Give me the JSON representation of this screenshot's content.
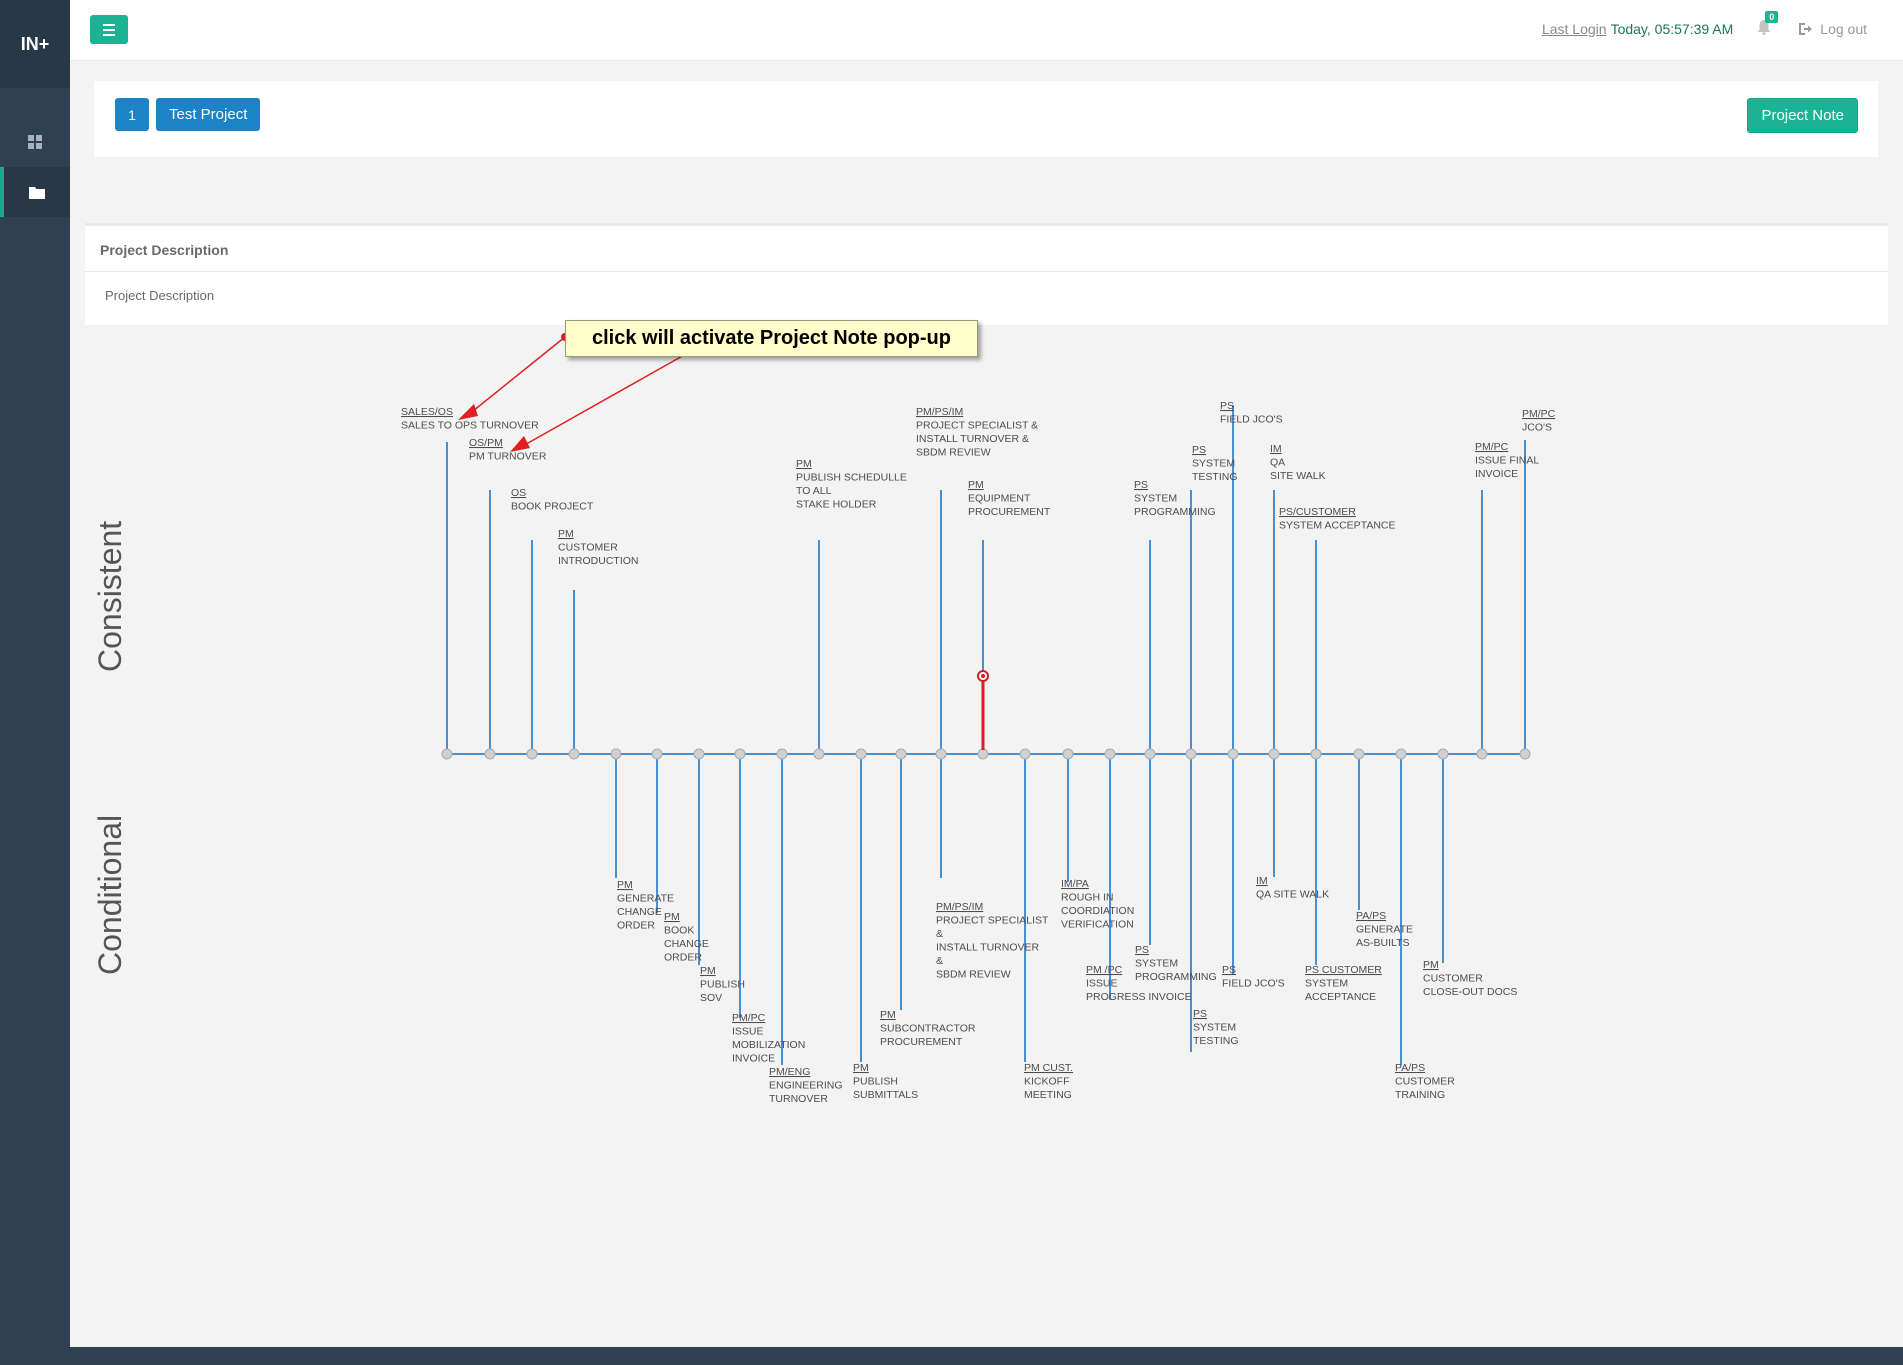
{
  "brand": "IN+",
  "header": {
    "last_login_label": "Last Login",
    "last_login_value": "Today, 05:57:39 AM",
    "notification_count": "0",
    "logout_label": "Log out"
  },
  "project": {
    "number": "1",
    "name": "Test Project",
    "note_button": "Project Note"
  },
  "description": {
    "title": "Project Description",
    "body": "Project Description"
  },
  "callout": "click will activate Project Note pop-up",
  "timeline": {
    "consistent_label": "Consistent",
    "conditional_label": "Conditional",
    "consistent": [
      {
        "role": "SALES/OS",
        "lines": [
          "SALES TO OPS TURNOVER"
        ]
      },
      {
        "role": "OS/PM",
        "lines": [
          "PM TURNOVER"
        ]
      },
      {
        "role": "OS",
        "lines": [
          "BOOK PROJECT"
        ]
      },
      {
        "role": "PM",
        "lines": [
          "CUSTOMER",
          "INTRODUCTION"
        ]
      },
      {
        "role": "PM",
        "lines": [
          "PUBLISH SCHEDULLE",
          "TO ALL",
          "STAKE HOLDER"
        ]
      },
      {
        "role": "PM/PS/IM",
        "lines": [
          "PROJECT SPECIALIST &",
          "INSTALL TURNOVER &",
          "SBDM REVIEW"
        ]
      },
      {
        "role": "PM",
        "lines": [
          "EQUIPMENT",
          "PROCUREMENT"
        ]
      },
      {
        "role": "PS",
        "lines": [
          "SYSTEM",
          "PROGRAMMING"
        ]
      },
      {
        "role": "PS",
        "lines": [
          "SYSTEM",
          "TESTING"
        ]
      },
      {
        "role": "PS",
        "lines": [
          "FIELD JCO'S"
        ]
      },
      {
        "role": "IM",
        "lines": [
          "QA",
          "SITE WALK"
        ]
      },
      {
        "role": "PS/CUSTOMER",
        "lines": [
          "SYSTEM ACCEPTANCE"
        ]
      },
      {
        "role": "PM/PC",
        "lines": [
          "ISSUE FINAL",
          "INVOICE"
        ]
      },
      {
        "role": "PM/PC",
        "lines": [
          "JCO'S"
        ]
      }
    ],
    "conditional": [
      {
        "role": "PM",
        "lines": [
          "GENERATE",
          "CHANGE",
          "ORDER"
        ]
      },
      {
        "role": "PM",
        "lines": [
          "BOOK",
          "CHANGE",
          "ORDER"
        ]
      },
      {
        "role": "PM",
        "lines": [
          "PUBLISH",
          "SOV"
        ]
      },
      {
        "role": "PM/PC",
        "lines": [
          "ISSUE",
          "MOBILIZATION",
          "INVOICE"
        ]
      },
      {
        "role": "PM/ENG",
        "lines": [
          "ENGINEERING",
          "TURNOVER"
        ]
      },
      {
        "role": "PM",
        "lines": [
          "PUBLISH",
          "SUBMITTALS"
        ]
      },
      {
        "role": "PM",
        "lines": [
          "SUBCONTRACTOR",
          "PROCUREMENT"
        ]
      },
      {
        "role": "PM/PS/IM",
        "lines": [
          "PROJECT SPECIALIST",
          "&",
          "INSTALL TURNOVER",
          "&",
          "SBDM REVIEW"
        ]
      },
      {
        "role": "PM CUST.",
        "lines": [
          "KICKOFF",
          "MEETING"
        ]
      },
      {
        "role": "IM/PA",
        "lines": [
          "ROUGH IN",
          "COORDIATION",
          "VERIFICATION"
        ]
      },
      {
        "role": "PM /PC",
        "lines": [
          "ISSUE",
          "PROGRESS INVOICE"
        ]
      },
      {
        "role": "PS",
        "lines": [
          "SYSTEM",
          "PROGRAMMING"
        ]
      },
      {
        "role": "PS",
        "lines": [
          "SYSTEM",
          "TESTING"
        ]
      },
      {
        "role": "PS",
        "lines": [
          "FIELD JCO'S"
        ]
      },
      {
        "role": "IM",
        "lines": [
          "QA SITE WALK"
        ]
      },
      {
        "role": "PS CUSTOMER",
        "lines": [
          "SYSTEM",
          "ACCEPTANCE"
        ]
      },
      {
        "role": "PA/PS",
        "lines": [
          "GENERATE",
          "AS-BUILTS"
        ]
      },
      {
        "role": "PA/PS",
        "lines": [
          "CUSTOMER",
          "TRAINING"
        ]
      },
      {
        "role": "PM",
        "lines": [
          "CUSTOMER",
          "CLOSE-OUT DOCS"
        ]
      }
    ]
  },
  "colors": {
    "sidebar": "#2f4050",
    "accent": "#1ab394",
    "primary": "#1c84c6",
    "timeline_line": "#4a8fd0"
  }
}
